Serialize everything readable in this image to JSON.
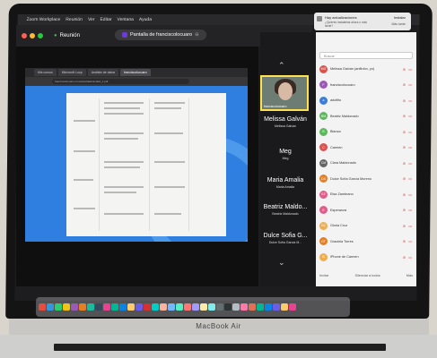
{
  "menubar": {
    "app": "Zoom Workplace",
    "items": [
      "Reunión",
      "Ver",
      "Editar",
      "Ventana",
      "Ayuda"
    ]
  },
  "zoom": {
    "meeting_label": "Reunión",
    "share_label": "Pantalla de franciscolocuaro"
  },
  "browser": {
    "tabs": [
      "Mis cursos",
      "Microsoft Loop",
      "Análisis de datos",
      "franciscolocuaro"
    ],
    "url": "franciscolocuaro.com/actividad/unidad_1.pdf"
  },
  "notification": {
    "title": "Hay actualizaciones",
    "body": "¿Quieres instalarlas ahora o más tarde?",
    "primary": "Instalar",
    "secondary": "Más tarde"
  },
  "video_tiles": [
    {
      "name": "Melissa Galván",
      "sub": "Melissa Galván"
    },
    {
      "name": "Meg",
      "sub": "Meg"
    },
    {
      "name": "Maria Amalia",
      "sub": "Maria Amalia"
    },
    {
      "name": "Beatriz Maldo...",
      "sub": "Beatriz Maldonado"
    },
    {
      "name": "Dulce Sofia G...",
      "sub": "Dulce Sofía García M..."
    }
  ],
  "thumb_label": "franciscolocuaro",
  "participants_panel": {
    "search_placeholder": "Buscar",
    "participants": [
      {
        "initials": "MG",
        "name": "Melissa Galván (anfitrión, yo)",
        "color": "#d9534f"
      },
      {
        "initials": "F",
        "name": "franciscolocuaro",
        "color": "#9b59b6"
      },
      {
        "initials": "a",
        "name": "adolfito",
        "color": "#3b7dd8"
      },
      {
        "initials": "BM",
        "name": "Beatriz Maldonado",
        "color": "#5cb85c"
      },
      {
        "initials": "B",
        "name": "Blanca",
        "color": "#5cb85c"
      },
      {
        "initials": "C",
        "name": "Carmen",
        "color": "#d9534f"
      },
      {
        "initials": "CM",
        "name": "Clara Maldonado",
        "color": "#666666"
      },
      {
        "initials": "DS",
        "name": "Dulce Sofía García Moreno",
        "color": "#e67e22"
      },
      {
        "initials": "EZ",
        "name": "Elsa Zambrano",
        "color": "#e05c8a"
      },
      {
        "initials": "E",
        "name": "Esperanza",
        "color": "#e05c8a"
      },
      {
        "initials": "GC",
        "name": "Gloria Cruz",
        "color": "#f0ad4e"
      },
      {
        "initials": "GT",
        "name": "Graciela Torres",
        "color": "#e67e22"
      },
      {
        "initials": "IC",
        "name": "iPhone de Carmen",
        "color": "#f0ad4e"
      }
    ],
    "footer": {
      "invite": "Invitar",
      "mute_all": "Silenciar a todos",
      "more": "Más"
    }
  },
  "laptop_brand": "MacBook Air",
  "dock_colors": [
    "#e74c3c",
    "#3498db",
    "#2ecc71",
    "#f1c40f",
    "#9b59b6",
    "#e67e22",
    "#1abc9c",
    "#34495e",
    "#e84393",
    "#00b894",
    "#0984e3",
    "#fdcb6e",
    "#6c5ce7",
    "#d63031",
    "#00cec9",
    "#fab1a0",
    "#74b9ff",
    "#55efc4",
    "#ff7675",
    "#a29bfe",
    "#ffeaa7",
    "#81ecec",
    "#636e72",
    "#2d3436",
    "#b2bec3",
    "#fd79a8",
    "#e17055",
    "#00b894",
    "#0984e3",
    "#6c5ce7",
    "#fdcb6e",
    "#e84393"
  ]
}
